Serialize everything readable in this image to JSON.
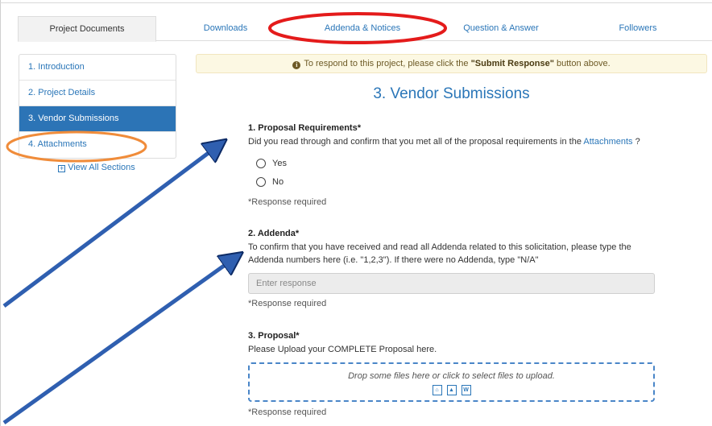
{
  "tabs": [
    {
      "label": "Project Documents"
    },
    {
      "label": "Downloads"
    },
    {
      "label": "Addenda & Notices"
    },
    {
      "label": "Question & Answer"
    },
    {
      "label": "Followers"
    }
  ],
  "sidebar": {
    "items": [
      {
        "label": "1. Introduction"
      },
      {
        "label": "2. Project Details"
      },
      {
        "label": "3. Vendor Submissions"
      },
      {
        "label": "4. Attachments"
      }
    ],
    "view_all_label": "View All Sections"
  },
  "notice": {
    "prefix": "To respond to this project, please click the ",
    "bold": "\"Submit Response\"",
    "suffix": " button above."
  },
  "section_title": "3. Vendor Submissions",
  "questions": {
    "q1": {
      "title": "1. Proposal Requirements*",
      "text_before": "Did you read through and confirm that you met all of the proposal requirements in the ",
      "link": "Attachments",
      "text_after": " ?",
      "options": [
        "Yes",
        "No"
      ],
      "required_note": "*Response required"
    },
    "q2": {
      "title": "2. Addenda*",
      "text": "To confirm that you have received and read all Addenda related to this solicitation, please type the Addenda numbers here (i.e. \"1,2,3\").  If there were no Addenda, type \"N/A\"",
      "placeholder": "Enter response",
      "value": "",
      "required_note": "*Response required"
    },
    "q3": {
      "title": "3. Proposal*",
      "text": "Please Upload your COMPLETE Proposal here.",
      "dropzone_text": "Drop some files here or click to select files to upload.",
      "file_icons": [
        "pdf-icon",
        "image-icon",
        "word-icon"
      ],
      "required_note": "*Response required"
    }
  },
  "colors": {
    "accent": "#2a76b8",
    "active_sidebar": "#2c74b6",
    "notice_bg": "#fcf8e3",
    "annotation_red": "#e41b1b",
    "annotation_orange": "#f08c3a",
    "annotation_arrow": "#2f5fb0"
  }
}
